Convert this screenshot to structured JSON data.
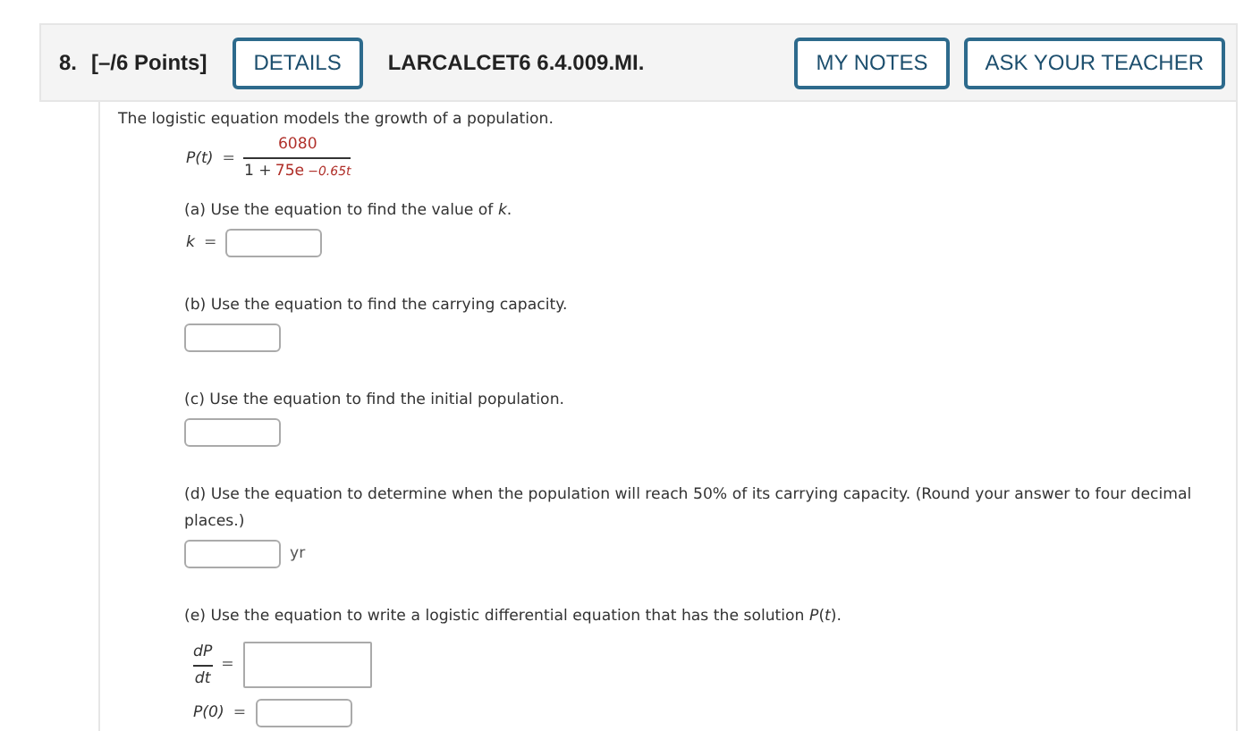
{
  "header": {
    "number": "8.",
    "points": "[–/6 Points]",
    "details_button": "DETAILS",
    "code": "LARCALCET6 6.4.009.MI.",
    "buttons": [
      "MY NOTES",
      "ASK YOUR TEACHER"
    ]
  },
  "intro": "The logistic equation models the growth of a population.",
  "formula": {
    "lhs": "P(t)",
    "equals": "=",
    "numerator": "6080",
    "denominator_lead": "1 +",
    "denominator_term": "75e",
    "denominator_exponent": "−0.65t"
  },
  "parts": [
    {
      "kind": "labeled",
      "text": "(a) Use the equation to find the value of *k*.",
      "label": "k",
      "equals": "="
    },
    {
      "kind": "box",
      "text": "(b) Use the equation to find the carrying capacity."
    },
    {
      "kind": "box",
      "text": "(c) Use the equation to find the initial population."
    },
    {
      "kind": "unit",
      "text": "(d) Use the equation to determine when the population will reach 50% of its carrying capacity. (Round your answer to four decimal places.)",
      "unit": "yr"
    },
    {
      "kind": "differential",
      "text": "(e) Use the equation to write a logistic differential equation that has the solution  *P*(*t*).",
      "numerator": "dP",
      "denominator": "dt",
      "equals": "=",
      "initial_label": "P(0)",
      "initial_equals": "="
    }
  ]
}
